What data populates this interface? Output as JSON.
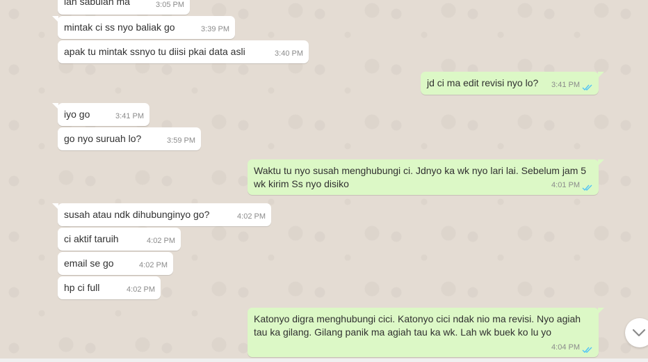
{
  "messages": [
    {
      "direction": "in",
      "text": "lah sabulan ma",
      "time": "3:05 PM"
    },
    {
      "direction": "in",
      "text": "mintak ci ss nyo baliak go",
      "time": "3:39 PM"
    },
    {
      "direction": "in",
      "text": "apak tu mintak ssnyo tu diisi pkai data asli",
      "time": "3:40 PM"
    },
    {
      "direction": "out",
      "text": "jd ci ma edit revisi nyo lo?",
      "time": "3:41 PM",
      "status": "read"
    },
    {
      "direction": "in",
      "text": "iyo go",
      "time": "3:41 PM"
    },
    {
      "direction": "in",
      "text": "go nyo suruah lo?",
      "time": "3:59 PM"
    },
    {
      "direction": "out",
      "text": "Waktu tu nyo susah menghubungi ci. Jdnyo ka wk nyo lari lai. Sebelum jam 5 wk kirim Ss nyo disiko",
      "time": "4:01 PM",
      "status": "read"
    },
    {
      "direction": "in",
      "text": "susah atau ndk dihubunginyo go?",
      "time": "4:02 PM"
    },
    {
      "direction": "in",
      "text": "ci aktif taruih",
      "time": "4:02 PM"
    },
    {
      "direction": "in",
      "text": "email se go",
      "time": "4:02 PM"
    },
    {
      "direction": "in",
      "text": "hp ci full",
      "time": "4:02 PM"
    },
    {
      "direction": "out",
      "text": "Katonyo digra menghubungi cici. Katonyo cici ndak nio ma revisi. Nyo agiah tau ka gilang. Gilang panik ma agiah tau ka wk. Lah wk buek ko lu yo",
      "time": "4:04 PM",
      "status": "read"
    }
  ],
  "colors": {
    "background": "#e4dcd3",
    "incoming_bubble": "#ffffff",
    "outgoing_bubble": "#dcf8c6",
    "read_ticks": "#4fc3f7"
  },
  "icons": {
    "read_receipt": "double-check-icon",
    "scroll_down": "chevron-down-icon"
  }
}
